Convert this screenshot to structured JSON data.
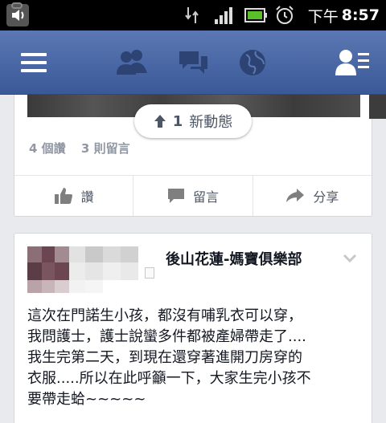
{
  "status_bar": {
    "ampm": "下午",
    "time": "8:57"
  },
  "feed": {
    "new_stories": {
      "count": "1",
      "label": "新動態"
    },
    "story1": {
      "likes": "4 個讚",
      "comments": "3 則留言",
      "actions": {
        "like": "讚",
        "comment": "留言",
        "share": "分享"
      }
    },
    "story2": {
      "page_name": "後山花蓮-媽寶俱樂部",
      "text": "這次在門諾生小孩，都沒有哺乳衣可以穿，\n我問護士，護士說蠻多件都被產婦帶走了....\n我生完第二天，到現在還穿著進開刀房穿的\n衣服.....所以在此呼籲一下，大家生完小孩不\n要帶走蛤~~~~~"
    }
  },
  "colors": {
    "nav": "#3b5998",
    "background": "#e9eaed"
  }
}
